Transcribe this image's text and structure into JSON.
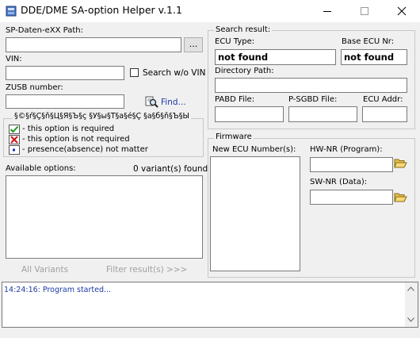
{
  "window": {
    "title": "DDE/DME SA-option Helper  v.1.1",
    "minimize_icon": "minimize-icon",
    "maximize_icon": "maximize-icon",
    "close_icon": "close-icon"
  },
  "left": {
    "sp_daten_label": "SP-Daten-eXX Path:",
    "sp_daten_value": "",
    "browse_label": "...",
    "vin_label": "VIN:",
    "vin_value": "",
    "search_wo_vin_label": "Search w/o VIN",
    "search_wo_vin_checked": false,
    "zusb_label": "ZUSB number:",
    "zusb_value": "",
    "find_label": "Find...",
    "legend": {
      "title": "§©§ŕ§Ç§ň§Ц§Я§Ъ§ç §У§ы§Т§а§é§Ç §а§б§ň§Ъ§Ы",
      "items": [
        {
          "icon": "green-check-icon",
          "text": "- this option is required"
        },
        {
          "icon": "red-cross-icon",
          "text": "- this option is not required"
        },
        {
          "icon": "blue-dot-icon",
          "text": "- presence(absence) not matter"
        }
      ]
    },
    "available_options_label": "Available options:",
    "variants_found": "0 variant(s) found",
    "all_variants_label": "All Variants",
    "filter_label": "Filter result(s) >>>"
  },
  "search_result": {
    "group_title": "Search result:",
    "ecu_type_label": "ECU Type:",
    "ecu_type_value": "not found",
    "base_ecu_label": "Base ECU Nr:",
    "base_ecu_value": "not found",
    "directory_label": "Directory Path:",
    "directory_value": "",
    "pabd_label": "PABD File:",
    "psgbd_label": "P-SGBD File:",
    "ecu_addr_label": "ECU Addr:"
  },
  "firmware": {
    "group_title": "Firmware",
    "new_ecu_label": "New ECU Number(s):",
    "hw_nr_label": "HW-NR (Program):",
    "sw_nr_label": "SW-NR (Data):",
    "folder_icon": "folder-open-icon"
  },
  "log": {
    "lines": [
      "14:24:16:  Program started..."
    ]
  },
  "colors": {
    "window_bg": "#f0f0f0",
    "log_text": "#1c3aa9",
    "disabled_text": "#a0a0a0"
  }
}
